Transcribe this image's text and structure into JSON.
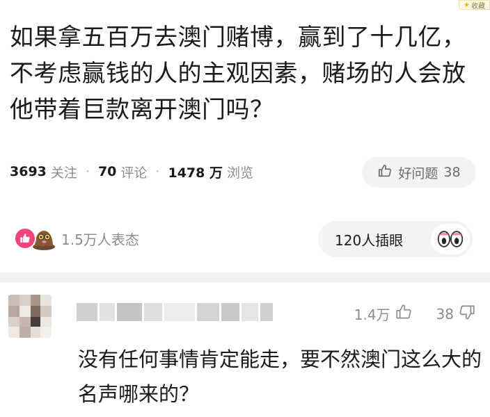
{
  "corner_badge": {
    "label": "收藏",
    "icon": "star-icon"
  },
  "question": {
    "title": "如果拿五百万去澳门赌博，赢到了十几亿，不考虑赢钱的人的主观因素，赌场的人会放他带着巨款离开澳门吗？"
  },
  "stats": {
    "follow_count": "3693",
    "follow_label": "关注",
    "comment_count": "70",
    "comment_label": "评论",
    "view_count": "1478 万",
    "view_label": "浏览",
    "separator": "·"
  },
  "good_question": {
    "label": "好问题",
    "count": "38",
    "icon": "thumb-up-icon"
  },
  "reactions": {
    "text": "1.5万人表态",
    "icons": [
      "thumb-up-badge-icon",
      "mole-emoji-icon"
    ],
    "accent": "#f0457a"
  },
  "eye_reaction": {
    "text": "120人插眼",
    "icon": "eyes-icon"
  },
  "comment": {
    "like_count": "1.4万",
    "dislike_count": "38",
    "text": "没有任何事情肯定能走，要不然澳门这么大的名声哪来的？",
    "like_icon": "thumb-up-outline-icon",
    "dislike_icon": "thumb-down-outline-icon"
  }
}
